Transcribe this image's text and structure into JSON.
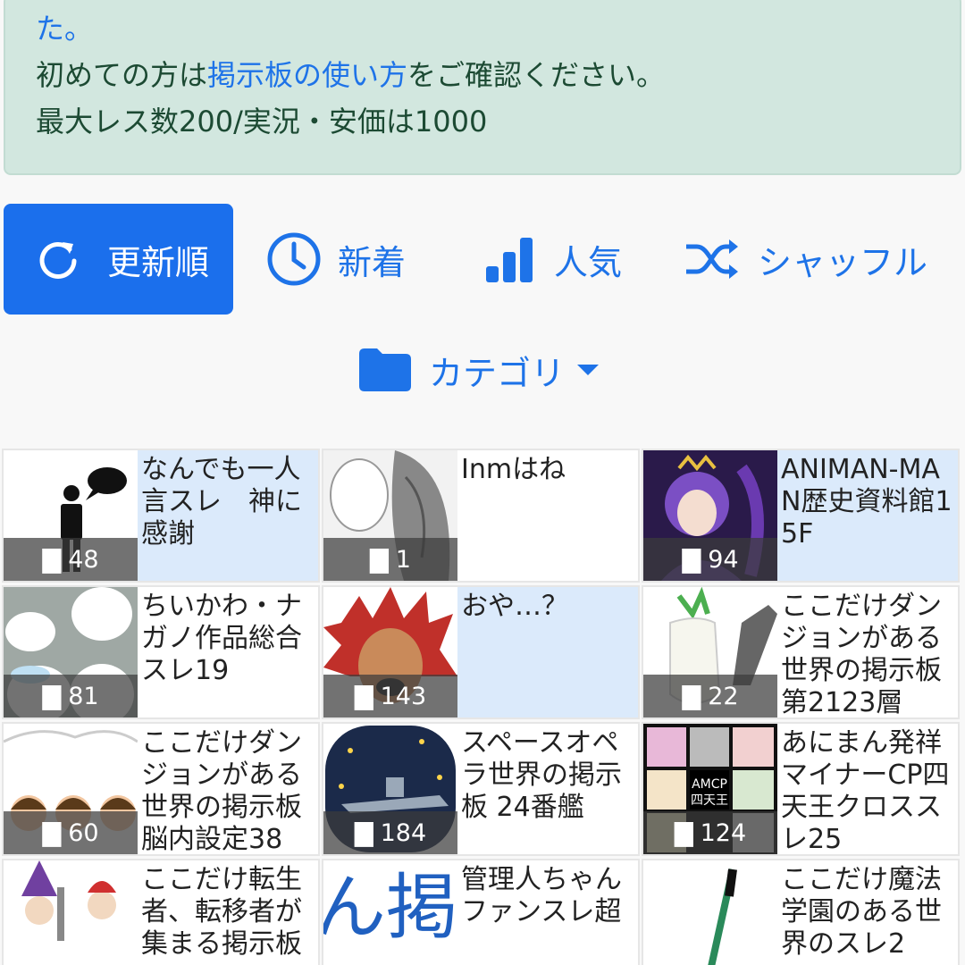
{
  "notice": {
    "line1": "た。",
    "line2_pre": "初めての方は",
    "line2_link": "掲示板の使い方",
    "line2_post": "をご確認ください。",
    "line3": "最大レス数200/実況・安価は1000"
  },
  "sort": {
    "update": "更新順",
    "new": "新着",
    "popular": "人気",
    "shuffle": "シャッフル",
    "category": "カテゴリ"
  },
  "colors": {
    "accent": "#1b6fec",
    "notice_bg": "#d2e7df",
    "highlight": "#dbeafb"
  },
  "threads": [
    {
      "title": "なんでも一人言スレ　神に感謝",
      "count": "48"
    },
    {
      "title": "Inmはね",
      "count": "1"
    },
    {
      "title": "ANIMAN-MAN歴史資料館15F",
      "count": "94"
    },
    {
      "title": "ちいかわ・ナガノ作品総合スレ19",
      "count": "81"
    },
    {
      "title": "おや…？",
      "count": "143"
    },
    {
      "title": "ここだけダンジョンがある世界の掲示板第2123層",
      "count": "22"
    },
    {
      "title": "ここだけダンジョンがある世界の掲示板脳内設定38",
      "count": "60"
    },
    {
      "title": "スペースオペラ世界の掲示板 24番艦",
      "count": "184"
    },
    {
      "title": "あにまん発祥マイナーCP四天王クロススレ25",
      "count": "124"
    },
    {
      "title": "ここだけ転生者、転移者が集まる掲示板",
      "count": ""
    },
    {
      "title": "管理人ちゃんファンスレ超",
      "count": ""
    },
    {
      "title": "ここだけ魔法学園のある世界のスレ2",
      "count": ""
    }
  ]
}
